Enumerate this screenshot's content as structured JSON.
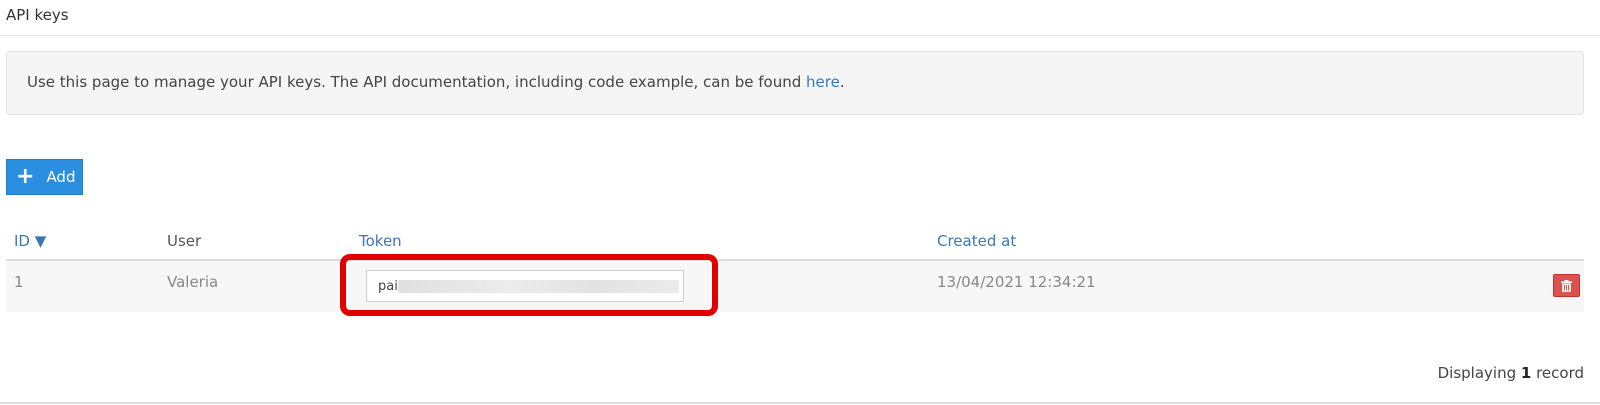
{
  "header": {
    "title": "API keys"
  },
  "info": {
    "text": "Use this page to manage your API keys. The API documentation, including code example, can be found ",
    "link_label": "here",
    "suffix": "."
  },
  "toolbar": {
    "add_icon": "+",
    "add_label": "Add"
  },
  "table": {
    "columns": {
      "id": "ID ▼",
      "user": "User",
      "token": "Token",
      "created_at": "Created at"
    },
    "rows": [
      {
        "id": "1",
        "user": "Valeria",
        "token": "paiR",
        "created_at": "13/04/2021 12:34:21",
        "delete_icon": "trash-icon"
      }
    ]
  },
  "footer": {
    "prefix": "Displaying ",
    "count": "1",
    "suffix": " record"
  },
  "colors": {
    "accent": "#2a8fe0",
    "link": "#3a78b5",
    "danger": "#d9534f",
    "highlight": "#e00000"
  }
}
